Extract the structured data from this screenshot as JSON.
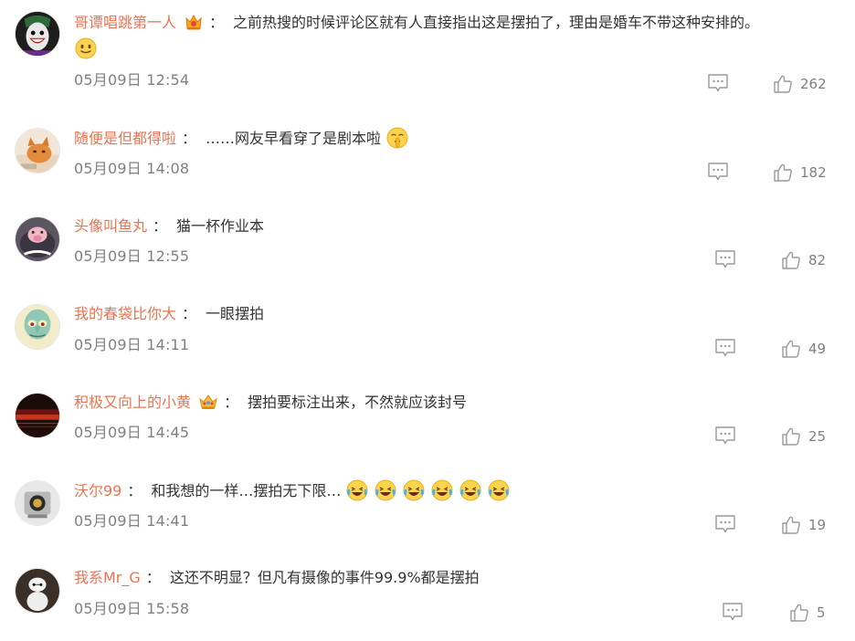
{
  "comments": [
    {
      "username": "哥谭唱跳第一人",
      "separator": "：",
      "text": "之前热搜的时候评论区就有人直接指出这是摆拍了，理由是婚车不带这种安排的。",
      "time": "05月09日 12:54",
      "likes": "262",
      "badge": "vip-crown-badge",
      "emoji": "smiling-face-emoji"
    },
    {
      "username": "随便是但都得啦",
      "separator": "：",
      "text": "……网友早看穿了是剧本啦",
      "time": "05月09日 14:08",
      "likes": "182",
      "emoji": "shushing-face-emoji"
    },
    {
      "username": "头像叫鱼丸",
      "separator": "：",
      "text": "猫一杯作业本",
      "time": "05月09日 12:55",
      "likes": "82"
    },
    {
      "username": "我的春袋比你大",
      "separator": "：",
      "text": "一眼摆拍",
      "time": "05月09日 14:11",
      "likes": "49"
    },
    {
      "username": "积极又向上的小黄",
      "separator": "：",
      "text": "摆拍要标注出来，不然就应该封号",
      "time": "05月09日 14:45",
      "likes": "25",
      "badge": "vip-crown-badge"
    },
    {
      "username": "沃尔99",
      "separator": "：",
      "text": "和我想的一样…摆拍无下限…",
      "time": "05月09日 14:41",
      "likes": "19",
      "emoji": "laughing-crying-emoji"
    },
    {
      "username": "我系Mr_G",
      "separator": "：",
      "text": "这还不明显？但凡有摄像的事件99.9%都是摆拍",
      "time": "05月09日 15:58",
      "likes": "5"
    }
  ],
  "colors": {
    "username": "#eb7350",
    "text": "#333333",
    "meta": "#808080",
    "icon": "#9a9a9a"
  },
  "icons": {
    "reply": "comment-icon",
    "like": "thumbs-up-icon"
  }
}
